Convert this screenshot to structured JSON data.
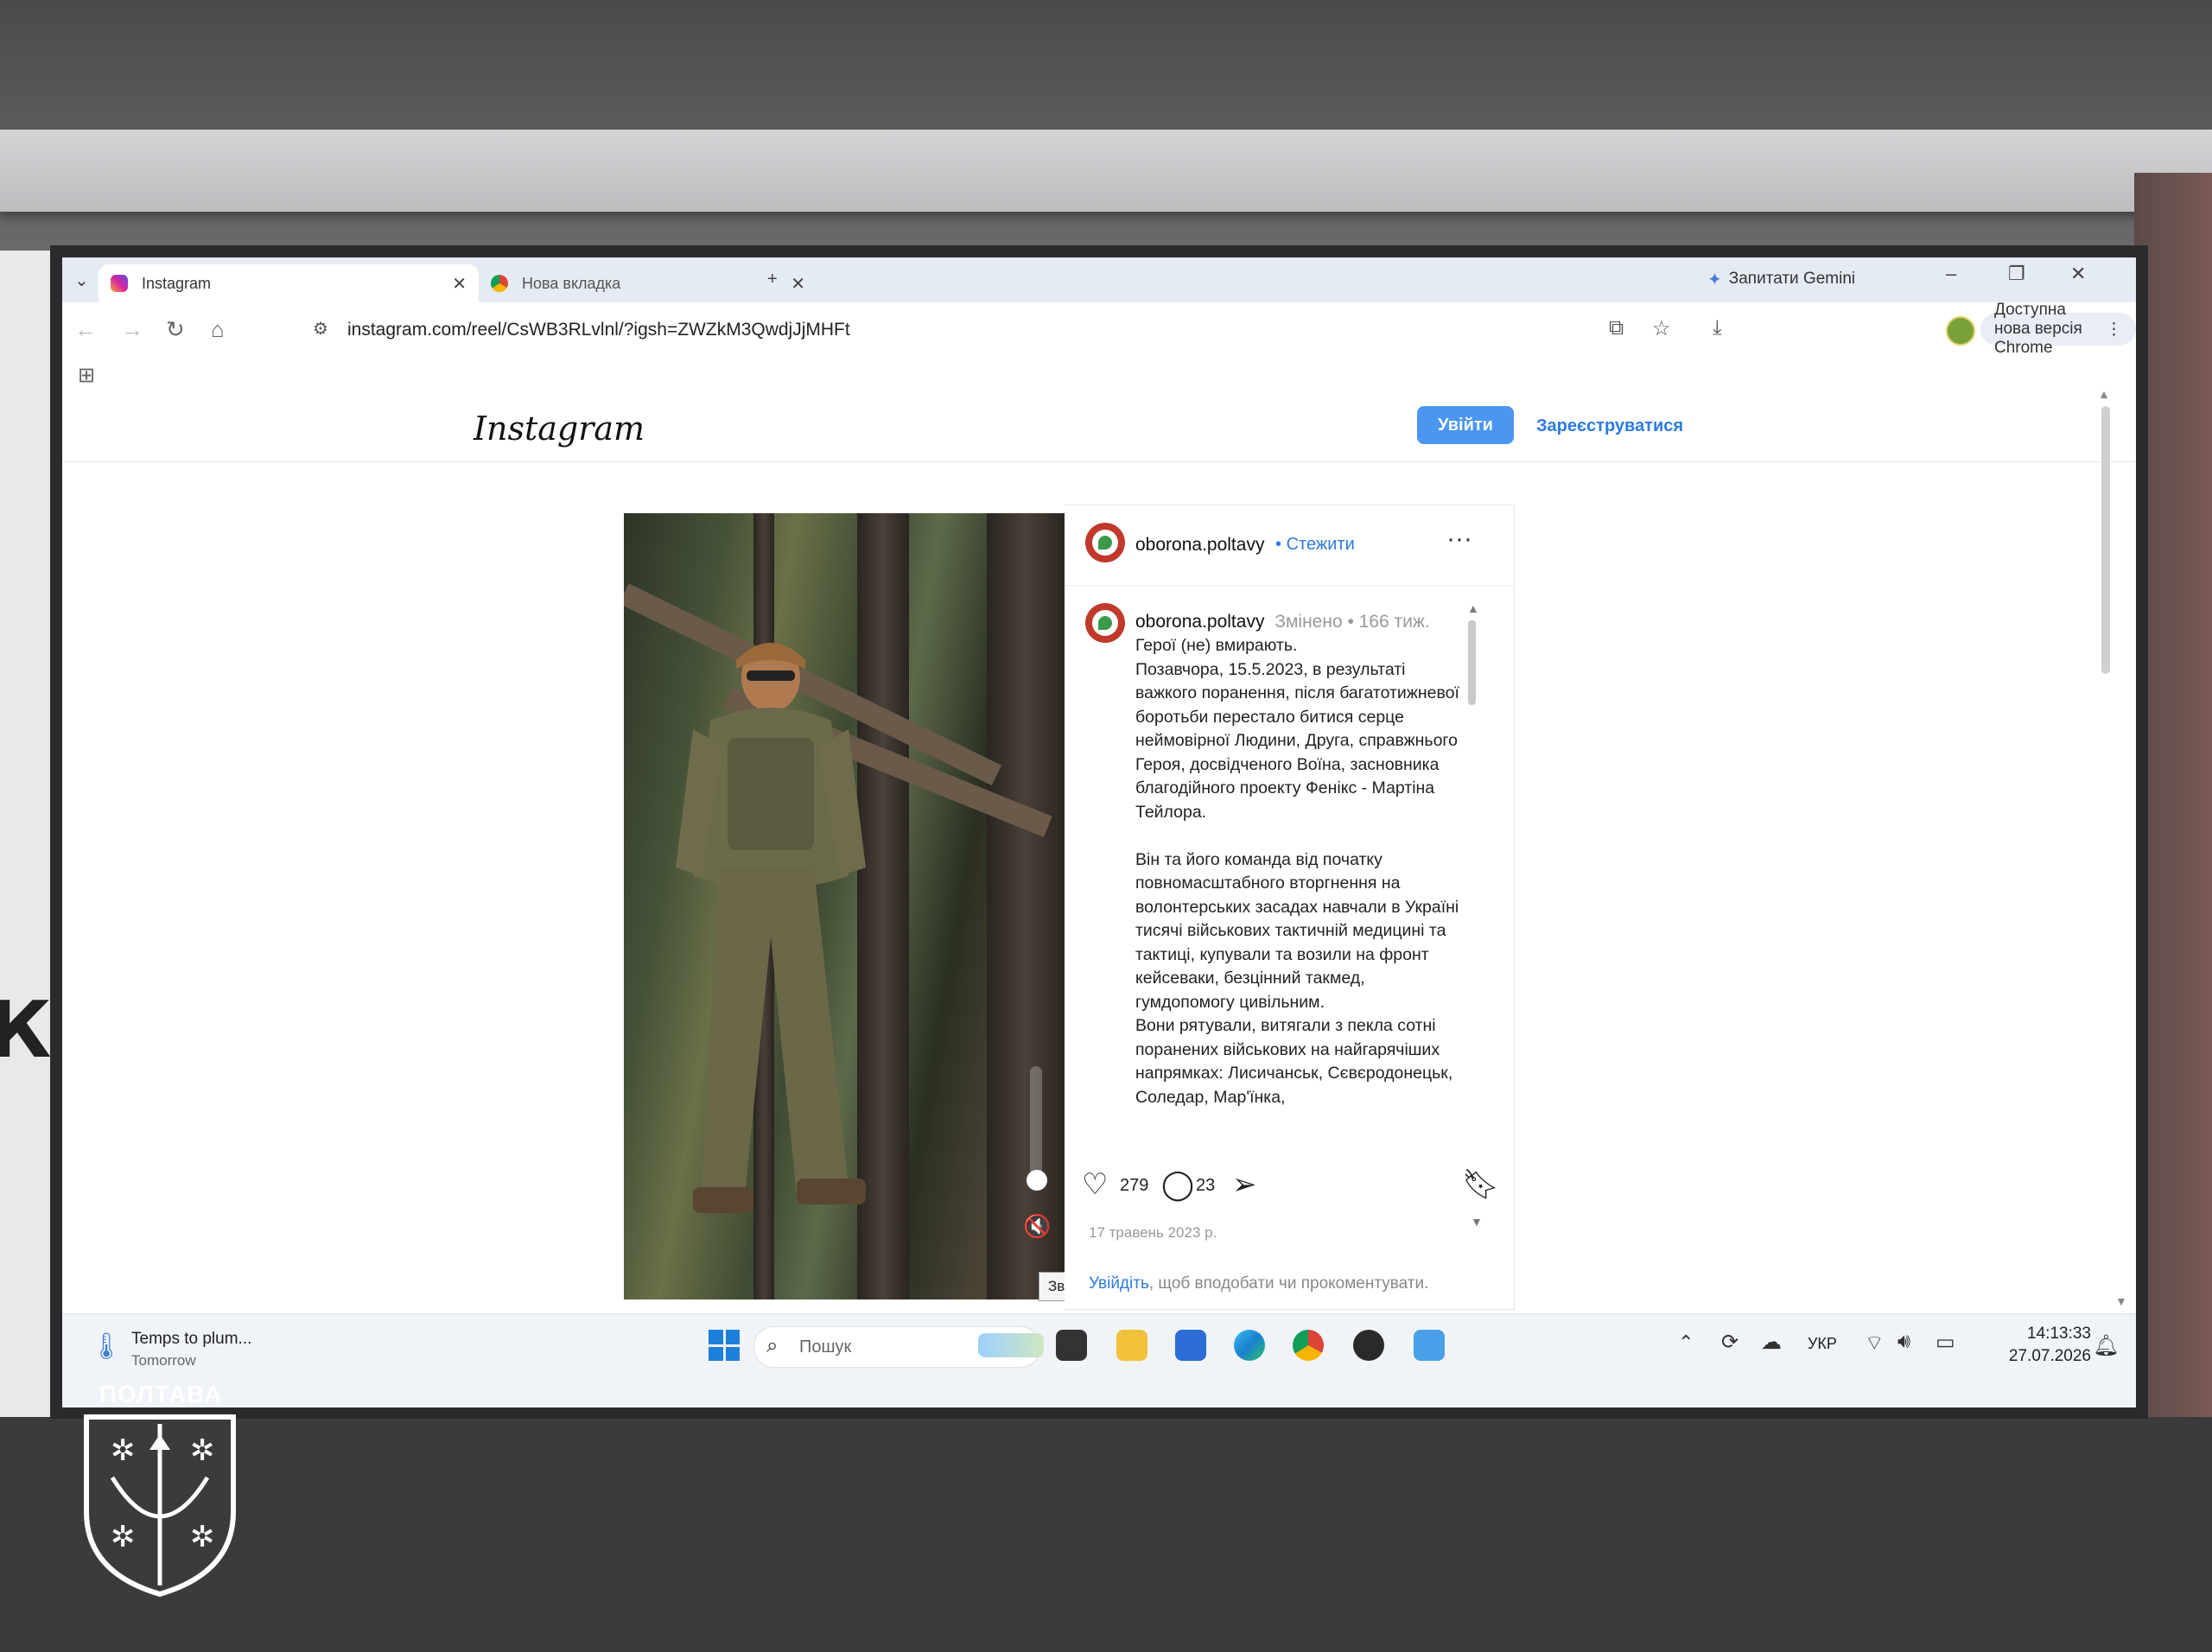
{
  "browser": {
    "tabs": [
      {
        "label": "Instagram",
        "icon": "instagram-icon",
        "active": true
      },
      {
        "label": "Нова вкладка",
        "icon": "chrome-icon",
        "active": false
      }
    ],
    "new_tab_label": "+",
    "gemini_label": "Запитати Gemini",
    "url": "instagram.com/reel/CsWB3RLvlnl/?igsh=ZWZkM3QwdjJjMHFt",
    "update_label": "Доступна нова версія Chrome"
  },
  "instagram": {
    "logo": "Instagram",
    "login_button": "Увійти",
    "signup_link": "Зареєструватися",
    "post": {
      "author": "oborona.poltavy",
      "separator": "•",
      "follow_label": "Стежити",
      "caption_meta": "Змінено •  166 тиж.",
      "caption": "Герої (не) вмирають.\nПозавчора, 15.5.2023, в результаті важкого поранення, після багатотижневої боротьби перестало битися серце неймовірної Людини, Друга, справжнього Героя, досвідченого Воїна, засновника благодійного проекту Фенікс - Мартіна Тейлора.\n\nВін та його команда від початку повномасштабного вторгнення на волонтерських засадах навчали в Україні тисячі військових тактичній медицині та тактиці, купували та возили на фронт кейсеваки, безцінний такмед, гумдопомогу цивільним.\nВони рятували, витягали з пекла сотні поранених військових на найгарячіших напрямках: Лисичанськ, Сєвєродонецьк, Соледар, Мар'їнка,",
      "likes": "279",
      "comments": "23",
      "date": "17 травень 2023 р.",
      "login_prompt_link": "Увійдіть",
      "login_prompt_rest": ", щоб вподобати чи прокоментувати.",
      "mute_tooltip": "Звук вимкнено"
    }
  },
  "taskbar": {
    "weather_title": "Temps to plum...",
    "weather_sub": "Tomorrow",
    "search_placeholder": "Пошук",
    "language": "УКР",
    "time": "14:13:33",
    "date": "27.07.2026"
  },
  "room": {
    "board_text": "КИ",
    "emblem_text": "ПОЛТАВА"
  },
  "colors": {
    "accent": "#4a96f0",
    "link": "#2c7be0",
    "avatar": "#c0392b"
  }
}
